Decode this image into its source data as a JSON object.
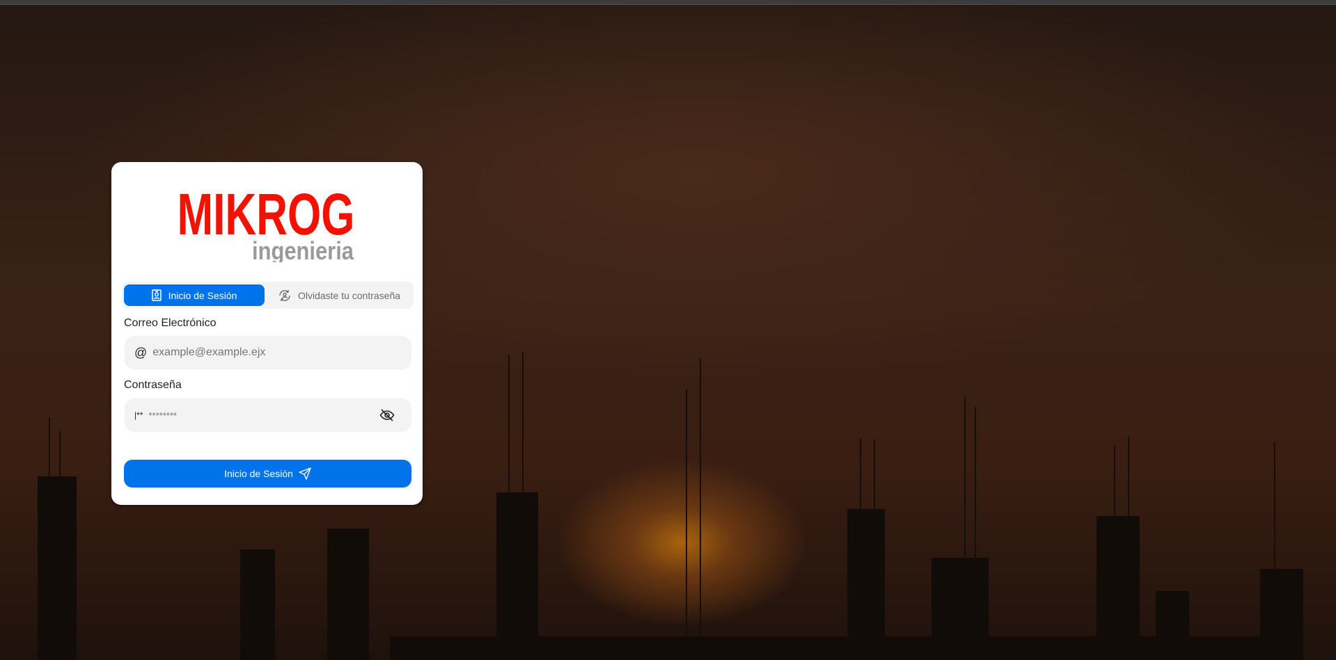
{
  "logo": {
    "brand": "MIKROG",
    "sub": "ingenieria",
    "brand_color": "#f21203",
    "sub_color": "#9a9a9a"
  },
  "tabs": [
    {
      "label": "Inicio de Sesión",
      "icon": "id-badge-icon",
      "active": true
    },
    {
      "label": "Olvidaste tu contraseña",
      "icon": "user-refresh-icon",
      "active": false
    }
  ],
  "email": {
    "label": "Correo Electrónico",
    "placeholder": "example@example.ejx",
    "icon": "at-icon"
  },
  "password": {
    "label": "Contraseña",
    "placeholder": "********",
    "prefix": "|**",
    "toggle_icon": "eye-off-icon"
  },
  "submit": {
    "label": "Inicio de Sesión",
    "icon": "send-icon"
  },
  "colors": {
    "accent": "#0072ea"
  }
}
